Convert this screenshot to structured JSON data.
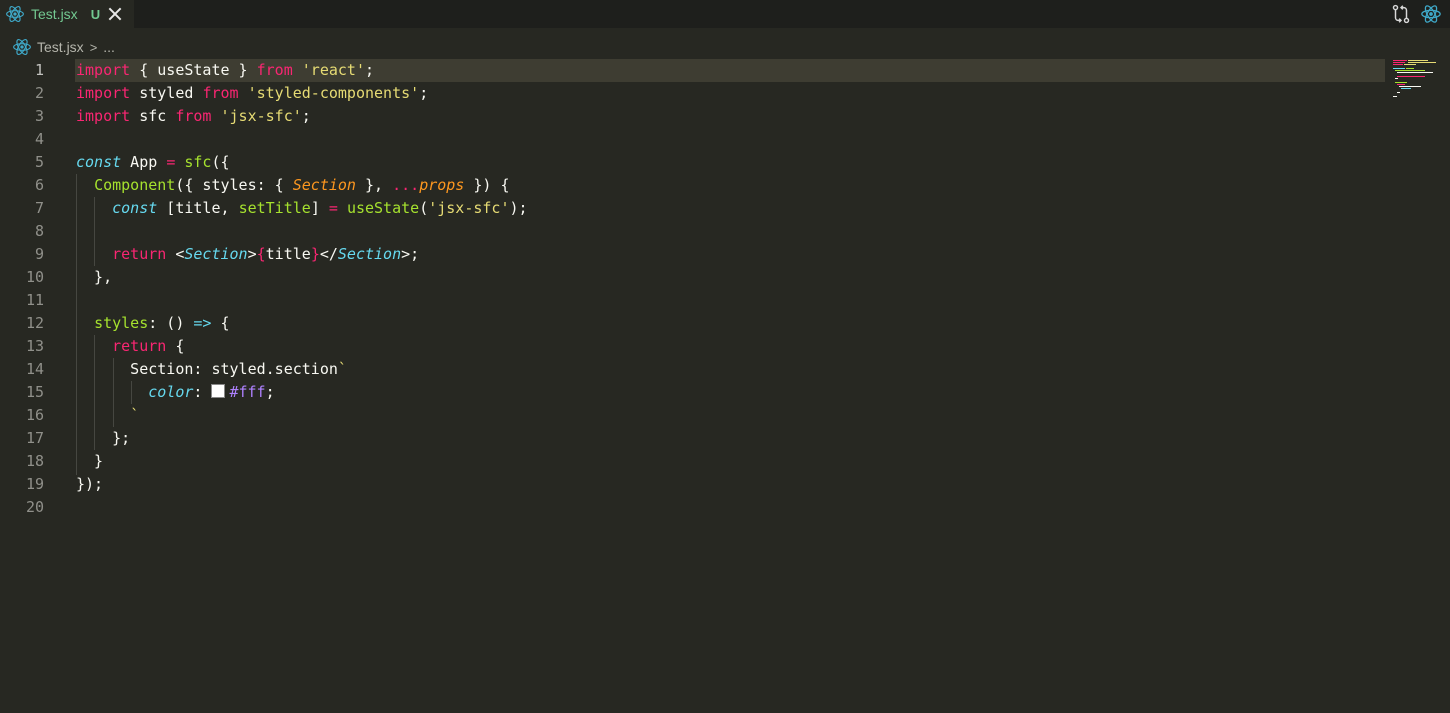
{
  "tab": {
    "title": "Test.jsx",
    "badge": "U",
    "icon": "react-icon"
  },
  "actions": {
    "compare_icon": "git-compare-icon",
    "react_icon": "react-icon"
  },
  "breadcrumb": {
    "file": "Test.jsx",
    "separator": ">",
    "more": "..."
  },
  "colors": {
    "background": "#272822",
    "keyword": "#f92672",
    "string": "#e6db74",
    "function": "#a6e22e",
    "type": "#66d9ef",
    "param": "#fd971f",
    "number": "#ae81ff",
    "tab_title": "#73c991"
  },
  "editor": {
    "current_line": 1,
    "lines": [
      {
        "n": "1",
        "tokens": [
          [
            "k",
            "import"
          ],
          [
            "d",
            " { useState } "
          ],
          [
            "k",
            "from"
          ],
          [
            "d",
            " "
          ],
          [
            "s",
            "'react'"
          ],
          [
            "d",
            ";"
          ]
        ]
      },
      {
        "n": "2",
        "tokens": [
          [
            "k",
            "import"
          ],
          [
            "d",
            " styled "
          ],
          [
            "k",
            "from"
          ],
          [
            "d",
            " "
          ],
          [
            "s",
            "'styled-components'"
          ],
          [
            "d",
            ";"
          ]
        ]
      },
      {
        "n": "3",
        "tokens": [
          [
            "k",
            "import"
          ],
          [
            "d",
            " sfc "
          ],
          [
            "k",
            "from"
          ],
          [
            "d",
            " "
          ],
          [
            "s",
            "'jsx-sfc'"
          ],
          [
            "d",
            ";"
          ]
        ]
      },
      {
        "n": "4",
        "tokens": []
      },
      {
        "n": "5",
        "tokens": [
          [
            "t",
            "const"
          ],
          [
            "d",
            " App "
          ],
          [
            "k",
            "="
          ],
          [
            "d",
            " "
          ],
          [
            "f",
            "sfc"
          ],
          [
            "d",
            "({"
          ]
        ]
      },
      {
        "n": "6",
        "tokens": [
          [
            "d",
            "  "
          ],
          [
            "f",
            "Component"
          ],
          [
            "d",
            "({ styles: { "
          ],
          [
            "p",
            "Section"
          ],
          [
            "d",
            " }, "
          ],
          [
            "k",
            "..."
          ],
          [
            "p",
            "props"
          ],
          [
            "d",
            " }) {"
          ]
        ]
      },
      {
        "n": "7",
        "tokens": [
          [
            "d",
            "    "
          ],
          [
            "t",
            "const"
          ],
          [
            "d",
            " [title, "
          ],
          [
            "f",
            "setTitle"
          ],
          [
            "d",
            "] "
          ],
          [
            "k",
            "="
          ],
          [
            "d",
            " "
          ],
          [
            "f",
            "useState"
          ],
          [
            "d",
            "("
          ],
          [
            "s",
            "'jsx-sfc'"
          ],
          [
            "d",
            ");"
          ]
        ]
      },
      {
        "n": "8",
        "tokens": []
      },
      {
        "n": "9",
        "tokens": [
          [
            "d",
            "    "
          ],
          [
            "k",
            "return"
          ],
          [
            "d",
            " <"
          ],
          [
            "t",
            "Section"
          ],
          [
            "d",
            ">"
          ],
          [
            "k",
            "{"
          ],
          [
            "d",
            "title"
          ],
          [
            "k",
            "}"
          ],
          [
            "d",
            "</"
          ],
          [
            "t",
            "Section"
          ],
          [
            "d",
            ">;"
          ]
        ]
      },
      {
        "n": "10",
        "tokens": [
          [
            "d",
            "  },"
          ]
        ]
      },
      {
        "n": "11",
        "tokens": []
      },
      {
        "n": "12",
        "tokens": [
          [
            "d",
            "  "
          ],
          [
            "f",
            "styles"
          ],
          [
            "d",
            ": () "
          ],
          [
            "t",
            "=>"
          ],
          [
            "d",
            " {"
          ]
        ]
      },
      {
        "n": "13",
        "tokens": [
          [
            "d",
            "    "
          ],
          [
            "k",
            "return"
          ],
          [
            "d",
            " {"
          ]
        ]
      },
      {
        "n": "14",
        "tokens": [
          [
            "d",
            "      Section: styled.section"
          ],
          [
            "s",
            "`"
          ]
        ]
      },
      {
        "n": "15",
        "tokens": [
          [
            "d",
            "        "
          ],
          [
            "t",
            "color"
          ],
          [
            "d",
            ": "
          ],
          [
            "swatch",
            ""
          ],
          [
            "m",
            "#fff"
          ],
          [
            "d",
            ";"
          ]
        ]
      },
      {
        "n": "16",
        "tokens": [
          [
            "d",
            "      "
          ],
          [
            "s",
            "`"
          ]
        ]
      },
      {
        "n": "17",
        "tokens": [
          [
            "d",
            "    };"
          ]
        ]
      },
      {
        "n": "18",
        "tokens": [
          [
            "d",
            "  }"
          ]
        ]
      },
      {
        "n": "19",
        "tokens": [
          [
            "d",
            "});"
          ]
        ]
      },
      {
        "n": "20",
        "tokens": []
      }
    ]
  }
}
